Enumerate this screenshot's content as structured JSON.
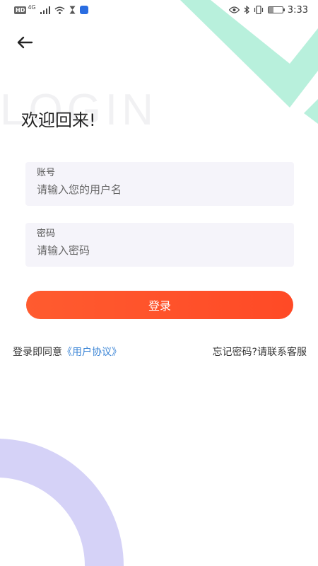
{
  "status_bar": {
    "hd": "HD",
    "network": "4G",
    "time": "3:33",
    "battery_level": 0.35
  },
  "login": {
    "watermark": "LOGIN",
    "welcome": "欢迎回来!",
    "account_label": "账号",
    "account_placeholder": "请输入您的用户名",
    "password_label": "密码",
    "password_placeholder": "请输入密码",
    "submit_label": "登录",
    "agreement_prefix": "登录即同意",
    "agreement_link": "《用户协议》",
    "forgot_text": "忘记密码?请联系客服"
  },
  "colors": {
    "accent": "#ff5131",
    "link": "#3b85d6",
    "deco_green": "#b8f0dc",
    "deco_purple": "#d5d2f7",
    "field_bg": "#f5f4fa"
  },
  "icons": {
    "back": "arrow-left-icon",
    "eye": "eye-icon",
    "bluetooth": "bluetooth-icon",
    "vibrate": "vibrate-icon",
    "wifi": "wifi-icon",
    "signal": "signal-icon",
    "hourglass": "hourglass-icon",
    "battery": "battery-icon"
  }
}
